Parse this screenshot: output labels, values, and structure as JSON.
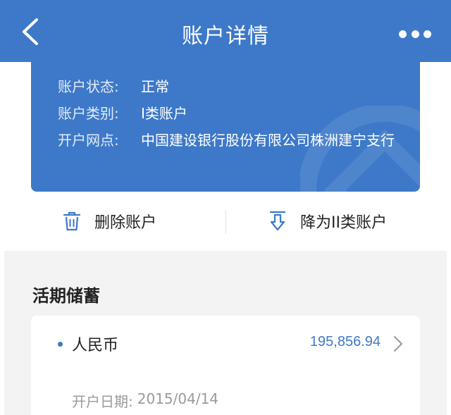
{
  "header": {
    "title": "账户详情"
  },
  "account": {
    "status_label": "账户状态:",
    "status_value": "正常",
    "type_label": "账户类别:",
    "type_value": "I类账户",
    "branch_label": "开户网点:",
    "branch_value": "中国建设银行股份有限公司株洲建宁支行"
  },
  "actions": {
    "delete_label": "删除账户",
    "downgrade_label": "降为II类账户"
  },
  "savings": {
    "section_title": "活期储蓄",
    "currency": "人民币",
    "amount": "195,856.94",
    "open_date_label": "开户日期:",
    "open_date_value": "2015/04/14"
  },
  "colors": {
    "brand_blue": "#3d79c8",
    "amount_blue": "#3d79c8",
    "section_bg": "#f3f3f3"
  },
  "icons": {
    "back": "chevron-left-icon",
    "more": "more-dots-icon",
    "delete": "trash-icon",
    "downgrade": "download-arrow-icon",
    "chevron": "chevron-right-icon"
  }
}
